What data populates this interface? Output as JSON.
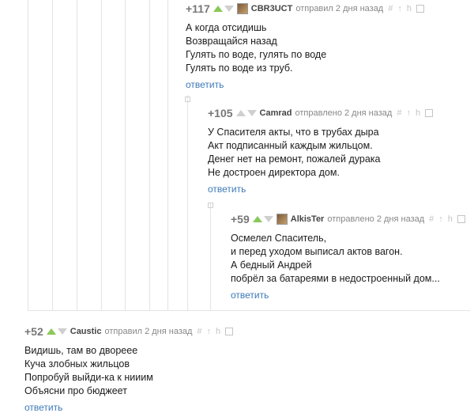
{
  "comments": [
    {
      "rating": "+117",
      "author": "CBR3UCT",
      "meta": "отправил 2 дня назад",
      "lines": [
        "А когда отсидишь",
        "Возвращайся назад",
        "Гулять по воде, гулять по воде",
        "Гулять по воде из труб."
      ],
      "reply": "ответить"
    },
    {
      "rating": "+105",
      "author": "Camrad",
      "meta": "отправлено 2 дня назад",
      "lines": [
        "У Спасителя акты, что в трубах дыра",
        "Акт подписанный каждым жильцом.",
        "Денег нет на ремонт, пожалей дурака",
        "Не достроен директора дом."
      ],
      "reply": "ответить"
    },
    {
      "rating": "+59",
      "author": "AlkisTer",
      "meta": "отправлено 2 дня назад",
      "lines": [
        "Осмелел Спаситель,",
        "и перед уходом выписал актов вагон.",
        "А бедный Андрей",
        "побрёл за батареями в недостроенный дом..."
      ],
      "reply": "ответить"
    },
    {
      "rating": "+52",
      "author": "Caustic",
      "meta": "отправил 2 дня назад",
      "lines": [
        "Видишь, там во двореее",
        "Куча злобных жильцов",
        "Попробуй выйди-ка к нииим",
        "Объясни про бюджеет"
      ],
      "reply": "ответить"
    }
  ],
  "tools": {
    "link": "#",
    "up": "↑",
    "parent": "h"
  },
  "icons": {
    "upvote": "arrow-up-icon",
    "downvote": "arrow-down-icon",
    "save": "save-icon",
    "collapse": "collapse-icon"
  },
  "colors": {
    "upvote_active": "#8ac858",
    "reply_link": "#3d79b9",
    "rating": "#777777"
  }
}
